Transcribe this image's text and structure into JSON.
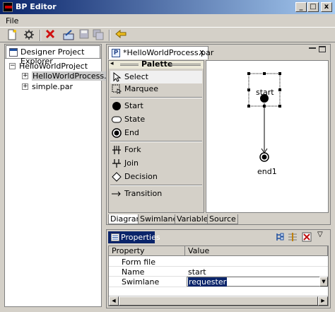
{
  "window": {
    "title": "BP Editor",
    "minimize": "_",
    "maximize": "□",
    "close": "x"
  },
  "menu": {
    "file": "File"
  },
  "explorer": {
    "tab_label": "Designer Project Explorer",
    "tab_close": "x",
    "project": "HelloWorldProject",
    "items": [
      "HelloWorldProcess.par",
      "simple.par"
    ]
  },
  "editor": {
    "tab_label": "*HelloWorldProcess.par",
    "tab_close": "x",
    "tab_icon": "P",
    "palette": {
      "title": "Palette",
      "tools": [
        "Select",
        "Marquee"
      ],
      "nodes": [
        "Start",
        "State",
        "End"
      ],
      "gateways": [
        "Fork",
        "Join",
        "Decision"
      ],
      "edges": [
        "Transition"
      ]
    },
    "canvas": {
      "start_label": "start",
      "end_label": "end1"
    },
    "bottom_tabs": [
      "Diagram",
      "Swimlanes",
      "Variables",
      "Source"
    ]
  },
  "properties": {
    "tab_label": "Properties",
    "columns": [
      "Property",
      "Value"
    ],
    "rows": [
      {
        "name": "Form file",
        "value": ""
      },
      {
        "name": "Name",
        "value": "start"
      },
      {
        "name": "Swimlane",
        "value": "requester"
      }
    ]
  },
  "colors": {
    "title_start": "#0a246a",
    "title_end": "#a6caf0",
    "selection": "#0a246a"
  }
}
